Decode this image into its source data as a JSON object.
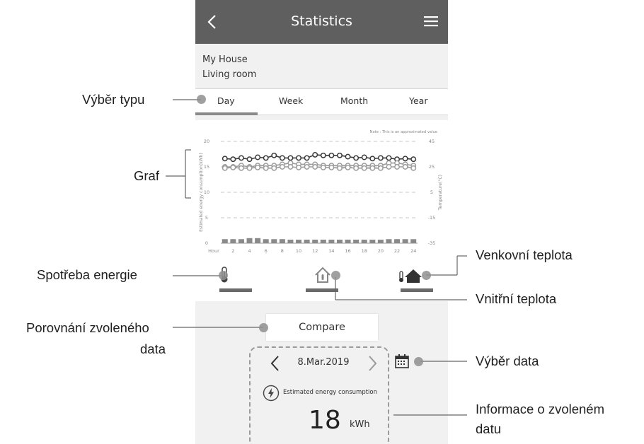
{
  "header": {
    "title": "Statistics",
    "back_icon": "chevron-left-icon",
    "menu_icon": "hamburger-menu-icon"
  },
  "location": {
    "house": "My House",
    "room": "Living room"
  },
  "tabs": [
    {
      "label": "Day",
      "selected": true
    },
    {
      "label": "Week",
      "selected": false
    },
    {
      "label": "Month",
      "selected": false
    },
    {
      "label": "Year",
      "selected": false
    }
  ],
  "chart_data": {
    "type": "line",
    "note": "Note : This is an approximated value",
    "ylabel_left": "Estimated energy consumption(kWh)",
    "ylabel_right": "Temperature(°C)",
    "x_label": "Hour",
    "x_ticks": [
      "2",
      "4",
      "6",
      "8",
      "10",
      "12",
      "14",
      "16",
      "18",
      "20",
      "22",
      "24"
    ],
    "y_left_ticks": [
      "0",
      "5",
      "10",
      "15",
      "20"
    ],
    "y_right_ticks": [
      "-35",
      "-15",
      "5",
      "25",
      "45"
    ],
    "ylim_left": [
      0,
      20
    ],
    "ylim_right": [
      -35,
      45
    ],
    "x": [
      1,
      2,
      3,
      4,
      5,
      6,
      7,
      8,
      9,
      10,
      11,
      12,
      13,
      14,
      15,
      16,
      17,
      18,
      19,
      20,
      21,
      22,
      23,
      24
    ],
    "series": [
      {
        "values": [
          31.5,
          31,
          32,
          31,
          32.5,
          32,
          34,
          32,
          32,
          32,
          32,
          34.5,
          34,
          34,
          34,
          33,
          32,
          32.5,
          31.5,
          32,
          32,
          31,
          31.5,
          31
        ]
      },
      {
        "values": [
          25,
          25,
          26,
          25,
          26,
          26,
          26,
          27,
          28,
          27,
          27,
          27,
          26,
          26,
          26,
          26,
          26,
          26,
          26,
          26,
          28,
          28,
          27,
          26
        ]
      },
      {
        "values": [
          24,
          24.5,
          24,
          24,
          24.5,
          24,
          24,
          25,
          25,
          24.5,
          25,
          25,
          24.5,
          24.5,
          24,
          24.5,
          24,
          24,
          24,
          24,
          25,
          25,
          25,
          24
        ]
      },
      {
        "type": "bar",
        "values": [
          0.8,
          0.8,
          0.8,
          1.0,
          1.0,
          0.8,
          0.8,
          0.8,
          0.7,
          0.7,
          0.7,
          0.7,
          0.7,
          0.7,
          0.7,
          0.7,
          0.7,
          0.7,
          0.7,
          0.7,
          0.8,
          0.8,
          0.8,
          0.8
        ]
      }
    ],
    "grid": true
  },
  "legend_icons": [
    {
      "name": "thermometer-icon",
      "selected": true
    },
    {
      "name": "house-temperature-icon",
      "selected": true
    },
    {
      "name": "outdoor-temperature-icon",
      "selected": true
    }
  ],
  "compare": {
    "label": "Compare"
  },
  "date": {
    "value": "8.Mar.2019",
    "calendar_icon": "calendar-icon"
  },
  "energy": {
    "label": "Estimated energy consumption",
    "value": "18",
    "unit": "kWh",
    "icon": "lightning-icon"
  },
  "callouts": {
    "type_select": "Výběr typu",
    "graph": "Graf",
    "energy_consumption": "Spotřeba energie",
    "compare_date_line1": "Porovnání zvoleného",
    "compare_date_line2": "data",
    "outdoor_temp": "Venkovní teplota",
    "indoor_temp": "Vnitřní teplota",
    "date_select": "Výběr data",
    "info_line1": "Informace o zvoleném",
    "info_line2": "datu"
  },
  "colors": {
    "topbar": "#5f5f5f",
    "series_dark": "#3a3a3a",
    "series_light": "#9c9c9c",
    "bars": "#8a8a8a"
  }
}
